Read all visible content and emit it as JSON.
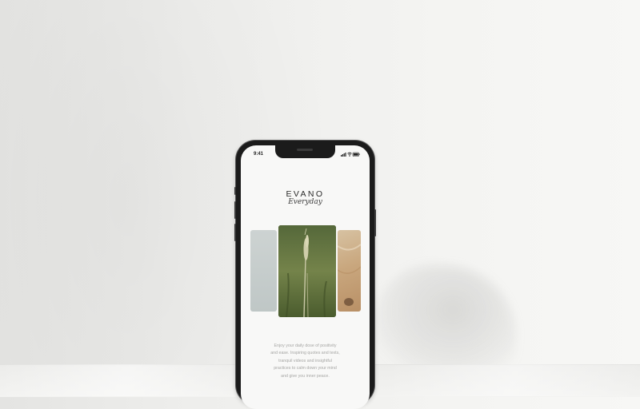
{
  "status_bar": {
    "time": "9:41",
    "icons": [
      "signal-icon",
      "wifi-icon",
      "battery-icon"
    ]
  },
  "app": {
    "brand": "EVANO",
    "tagline": "Everyday",
    "cards": [
      {
        "name": "card-mist",
        "color": "#c6cdcc"
      },
      {
        "name": "card-grass",
        "color": "#5f6f3a"
      },
      {
        "name": "card-sand",
        "color": "#c9a77e"
      }
    ],
    "description_lines": [
      "Enjoy your daily dose of positivity",
      "and ease. Inspiring quotes and texts,",
      "tranquil videos and insightful",
      "practices to calm down your mind",
      "and give you inner peace."
    ]
  }
}
